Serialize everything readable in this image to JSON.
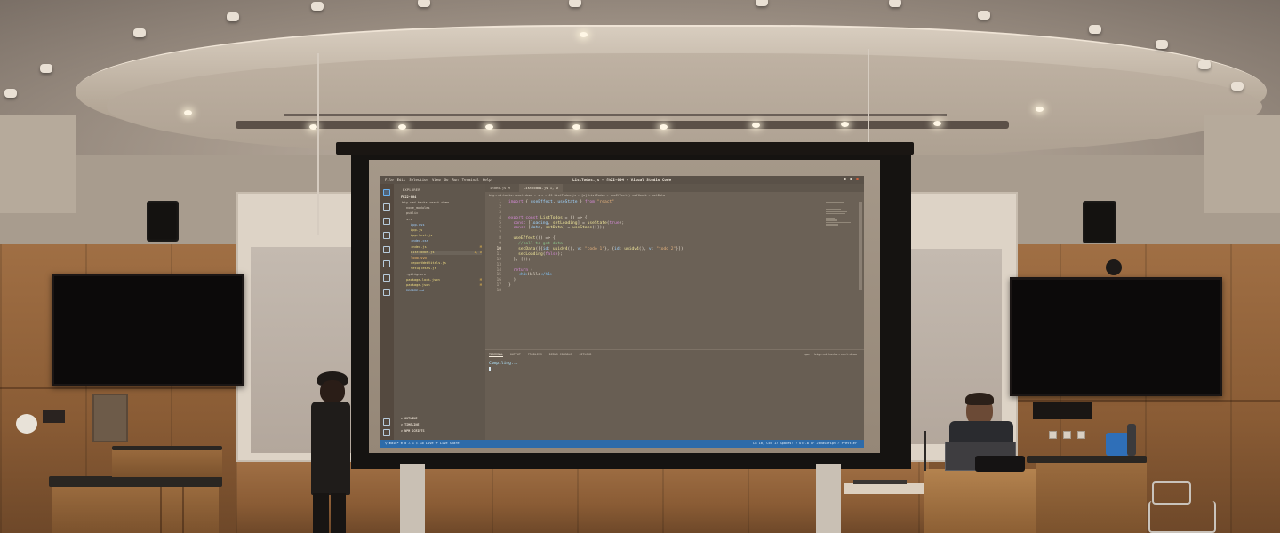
{
  "scene": {
    "description_type": "photo",
    "screen_app": {
      "window_title": "ListTodos.js - fh22-004 - Visual Studio Code",
      "menu": [
        "File",
        "Edit",
        "Selection",
        "View",
        "Go",
        "Run",
        "Terminal",
        "Help"
      ],
      "explorer": {
        "header": "EXPLORER",
        "project": "FH22-004",
        "files": [
          {
            "name": "big-red-hacks-react-demo",
            "indent": 1,
            "color": "#d9cfc0",
            "tag": ""
          },
          {
            "name": "node_modules",
            "indent": 2,
            "color": "#d9cfc0",
            "tag": ""
          },
          {
            "name": "public",
            "indent": 2,
            "color": "#d9cfc0",
            "tag": ""
          },
          {
            "name": "src",
            "indent": 2,
            "color": "#d9cfc0",
            "tag": ""
          },
          {
            "name": "App.css",
            "indent": 3,
            "color": "#9fd0ff",
            "tag": ""
          },
          {
            "name": "App.js",
            "indent": 3,
            "color": "#f0dc80",
            "tag": ""
          },
          {
            "name": "App.test.js",
            "indent": 3,
            "color": "#f0dc80",
            "tag": ""
          },
          {
            "name": "index.css",
            "indent": 3,
            "color": "#9fd0ff",
            "tag": ""
          },
          {
            "name": "index.js",
            "indent": 3,
            "color": "#f0dc80",
            "tag": "M"
          },
          {
            "name": "ListTodos.js",
            "indent": 3,
            "color": "#f0dc80",
            "tag": "1, U"
          },
          {
            "name": "logo.svg",
            "indent": 3,
            "color": "#f2b86a",
            "tag": ""
          },
          {
            "name": "reportWebVitals.js",
            "indent": 3,
            "color": "#f0dc80",
            "tag": ""
          },
          {
            "name": "setupTests.js",
            "indent": 3,
            "color": "#f0dc80",
            "tag": ""
          },
          {
            "name": ".gitignore",
            "indent": 2,
            "color": "#d9cfc0",
            "tag": ""
          },
          {
            "name": "package-lock.json",
            "indent": 2,
            "color": "#f0dc80",
            "tag": "M"
          },
          {
            "name": "package.json",
            "indent": 2,
            "color": "#f0dc80",
            "tag": "M"
          },
          {
            "name": "README.md",
            "indent": 2,
            "color": "#9fd0ff",
            "tag": ""
          }
        ],
        "outline_sections": [
          "OUTLINE",
          "TIMELINE",
          "NPM SCRIPTS"
        ]
      },
      "tabs": [
        {
          "label": "index.js M",
          "active": false
        },
        {
          "label": "ListTodos.js 1, U",
          "active": true
        }
      ],
      "breadcrumb": "big-red-hacks-react-demo > src > JS ListTodos.js > [o] ListTodos > useEffect() callback > setData",
      "code_lines": [
        {
          "n": "1",
          "text": [
            [
              "kw",
              "import "
            ],
            [
              "pl",
              "{ "
            ],
            [
              "id",
              "useEffect"
            ],
            [
              "pl",
              ", "
            ],
            [
              "id",
              "useState"
            ],
            [
              "pl",
              " } "
            ],
            [
              "kw",
              "from "
            ],
            [
              "str",
              "\"react\""
            ]
          ]
        },
        {
          "n": "2",
          "text": []
        },
        {
          "n": "3",
          "text": []
        },
        {
          "n": "4",
          "text": [
            [
              "kw",
              "export const "
            ],
            [
              "fn",
              "ListTodos"
            ],
            [
              "pl",
              " = () => {"
            ]
          ]
        },
        {
          "n": "5",
          "text": [
            [
              "pl",
              "  "
            ],
            [
              "kw",
              "const "
            ],
            [
              "pl",
              "["
            ],
            [
              "id",
              "loading"
            ],
            [
              "pl",
              ", "
            ],
            [
              "fn",
              "setLoading"
            ],
            [
              "pl",
              "] = "
            ],
            [
              "fn",
              "useState"
            ],
            [
              "pl",
              "("
            ],
            [
              "kw",
              "true"
            ],
            [
              "pl",
              ");"
            ]
          ]
        },
        {
          "n": "6",
          "text": [
            [
              "pl",
              "  "
            ],
            [
              "kw",
              "const "
            ],
            [
              "pl",
              "["
            ],
            [
              "id",
              "data"
            ],
            [
              "pl",
              ", "
            ],
            [
              "fn",
              "setData"
            ],
            [
              "pl",
              "] = "
            ],
            [
              "fn",
              "useState"
            ],
            [
              "pl",
              "([]);"
            ]
          ]
        },
        {
          "n": "7",
          "text": []
        },
        {
          "n": "8",
          "text": [
            [
              "pl",
              "  "
            ],
            [
              "fn",
              "useEffect"
            ],
            [
              "pl",
              "(() => {"
            ]
          ]
        },
        {
          "n": "9",
          "text": [
            [
              "cm",
              "    //call to get data"
            ]
          ]
        },
        {
          "n": "10",
          "text": [
            [
              "pl",
              "    "
            ],
            [
              "fn",
              "setData"
            ],
            [
              "pl",
              "([{"
            ],
            [
              "id",
              "id"
            ],
            [
              "pl",
              ": "
            ],
            [
              "fn",
              "uuidv4"
            ],
            [
              "pl",
              "(), "
            ],
            [
              "id",
              "v"
            ],
            [
              "pl",
              ": "
            ],
            [
              "str",
              "\"todo 1\""
            ],
            [
              "pl",
              "}, {"
            ],
            [
              "id",
              "id"
            ],
            [
              "pl",
              ": "
            ],
            [
              "fn",
              "uuidv4"
            ],
            [
              "pl",
              "(), "
            ],
            [
              "id",
              "v"
            ],
            [
              "pl",
              ": "
            ],
            [
              "str",
              "\"todo 2\""
            ],
            [
              "pl",
              "}])"
            ]
          ]
        },
        {
          "n": "11",
          "text": [
            [
              "pl",
              "    "
            ],
            [
              "fn",
              "setLoading"
            ],
            [
              "pl",
              "("
            ],
            [
              "kw",
              "false"
            ],
            [
              "pl",
              ");"
            ]
          ]
        },
        {
          "n": "12",
          "text": [
            [
              "pl",
              "  }, []);"
            ]
          ]
        },
        {
          "n": "13",
          "text": []
        },
        {
          "n": "14",
          "text": [
            [
              "pl",
              "  "
            ],
            [
              "kw",
              "return "
            ],
            [
              "pl",
              "("
            ]
          ]
        },
        {
          "n": "15",
          "text": [
            [
              "pl",
              "    "
            ],
            [
              "tg",
              "<h1>"
            ],
            [
              "pl",
              "Hello"
            ],
            [
              "tg",
              "</h1>"
            ]
          ]
        },
        {
          "n": "16",
          "text": [
            [
              "pl",
              "  )"
            ]
          ]
        },
        {
          "n": "17",
          "text": [
            [
              "pl",
              "}"
            ]
          ]
        },
        {
          "n": "18",
          "text": []
        }
      ],
      "current_line": "10",
      "panel": {
        "tabs": [
          "TERMINAL",
          "OUTPUT",
          "PROBLEMS",
          "DEBUG CONSOLE",
          "GITLENS"
        ],
        "active_tab": "TERMINAL",
        "terminal_label": "npm - big-red-hacks-react-demo",
        "terminal_output": "Compiling..."
      },
      "status_bar": {
        "left": "⚲ main*  ⊗ 0 ⚠ 1  ▷ Go Live  ⟳ Live Share",
        "right": "Ln 10, Col 17  Spaces: 2  UTF-8  LF  JavaScript  ✓ Prettier"
      }
    },
    "colors": {
      "status_bar": "#2d6ba9",
      "editor_bg": "#6b6156",
      "wood_panel": "#8a5c35"
    }
  }
}
